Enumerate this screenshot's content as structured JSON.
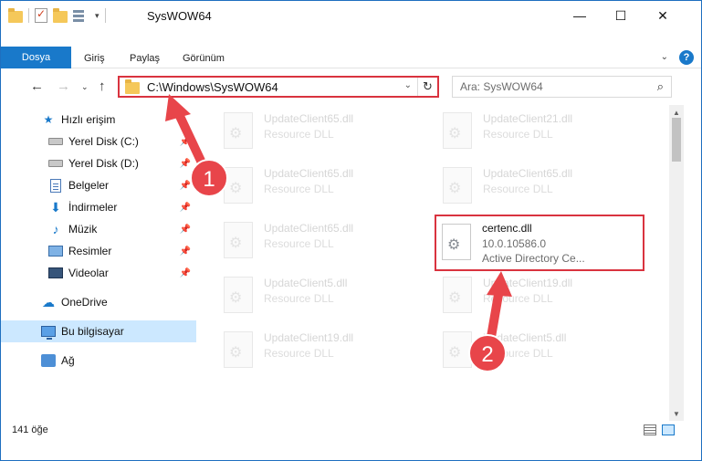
{
  "window": {
    "title": "SysWOW64"
  },
  "ribbon": {
    "tabs": [
      "Dosya",
      "Giriş",
      "Paylaş",
      "Görünüm"
    ]
  },
  "nav": {
    "address": "C:\\Windows\\SysWOW64",
    "search_placeholder": "Ara: SysWOW64"
  },
  "sidebar": {
    "quick_access": "Hızlı erişim",
    "items": [
      {
        "label": "Yerel Disk (C:)",
        "icon": "drive-icon",
        "pinned": true
      },
      {
        "label": "Yerel Disk (D:)",
        "icon": "drive-icon",
        "pinned": true
      },
      {
        "label": "Belgeler",
        "icon": "documents-icon",
        "pinned": true
      },
      {
        "label": "İndirmeler",
        "icon": "download-icon",
        "pinned": true
      },
      {
        "label": "Müzik",
        "icon": "music-icon",
        "pinned": true
      },
      {
        "label": "Resimler",
        "icon": "pictures-icon",
        "pinned": true
      },
      {
        "label": "Videolar",
        "icon": "videos-icon",
        "pinned": true
      }
    ],
    "onedrive": "OneDrive",
    "this_pc": "Bu bilgisayar",
    "network": "Ağ"
  },
  "files": [
    {
      "name": "UpdateClient65.dll",
      "desc": "Resource DLL"
    },
    {
      "name": "UpdateClient21.dll",
      "desc": "Resource DLL"
    },
    {
      "name": "UpdateClient65.dll",
      "desc": "Resource DLL"
    },
    {
      "name": "UpdateClient65.dll",
      "desc": "Resource DLL"
    },
    {
      "name": "UpdateClient65.dll",
      "desc": "Resource DLL"
    },
    {
      "name": "UpdateClient5.dll",
      "desc": "Resource DLL"
    },
    {
      "name": "UpdateClient19.dll",
      "desc": "Resource DLL"
    },
    {
      "name": "UpdateClient19.dll",
      "desc": "Resource DLL"
    },
    {
      "name": "UpdateClient5.dll",
      "desc": "Resource DLL"
    }
  ],
  "highlighted_file": {
    "name": "certenc.dll",
    "version": "10.0.10586.0",
    "desc": "Active Directory Ce..."
  },
  "annotations": {
    "step1": "1",
    "step2": "2",
    "accent_color": "#d9333f"
  },
  "status": {
    "item_count": "141 öğe"
  }
}
